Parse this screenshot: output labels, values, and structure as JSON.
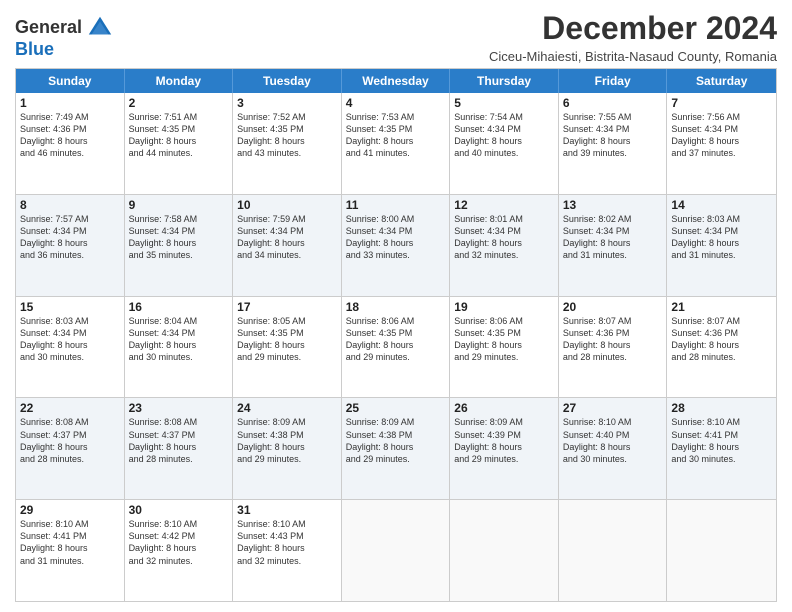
{
  "logo": {
    "general": "General",
    "blue": "Blue"
  },
  "header": {
    "title": "December 2024",
    "subtitle": "Ciceu-Mihaiesti, Bistrita-Nasaud County, Romania"
  },
  "days": [
    "Sunday",
    "Monday",
    "Tuesday",
    "Wednesday",
    "Thursday",
    "Friday",
    "Saturday"
  ],
  "weeks": [
    [
      {
        "day": 1,
        "lines": [
          "Sunrise: 7:49 AM",
          "Sunset: 4:36 PM",
          "Daylight: 8 hours",
          "and 46 minutes."
        ]
      },
      {
        "day": 2,
        "lines": [
          "Sunrise: 7:51 AM",
          "Sunset: 4:35 PM",
          "Daylight: 8 hours",
          "and 44 minutes."
        ]
      },
      {
        "day": 3,
        "lines": [
          "Sunrise: 7:52 AM",
          "Sunset: 4:35 PM",
          "Daylight: 8 hours",
          "and 43 minutes."
        ]
      },
      {
        "day": 4,
        "lines": [
          "Sunrise: 7:53 AM",
          "Sunset: 4:35 PM",
          "Daylight: 8 hours",
          "and 41 minutes."
        ]
      },
      {
        "day": 5,
        "lines": [
          "Sunrise: 7:54 AM",
          "Sunset: 4:34 PM",
          "Daylight: 8 hours",
          "and 40 minutes."
        ]
      },
      {
        "day": 6,
        "lines": [
          "Sunrise: 7:55 AM",
          "Sunset: 4:34 PM",
          "Daylight: 8 hours",
          "and 39 minutes."
        ]
      },
      {
        "day": 7,
        "lines": [
          "Sunrise: 7:56 AM",
          "Sunset: 4:34 PM",
          "Daylight: 8 hours",
          "and 37 minutes."
        ]
      }
    ],
    [
      {
        "day": 8,
        "lines": [
          "Sunrise: 7:57 AM",
          "Sunset: 4:34 PM",
          "Daylight: 8 hours",
          "and 36 minutes."
        ]
      },
      {
        "day": 9,
        "lines": [
          "Sunrise: 7:58 AM",
          "Sunset: 4:34 PM",
          "Daylight: 8 hours",
          "and 35 minutes."
        ]
      },
      {
        "day": 10,
        "lines": [
          "Sunrise: 7:59 AM",
          "Sunset: 4:34 PM",
          "Daylight: 8 hours",
          "and 34 minutes."
        ]
      },
      {
        "day": 11,
        "lines": [
          "Sunrise: 8:00 AM",
          "Sunset: 4:34 PM",
          "Daylight: 8 hours",
          "and 33 minutes."
        ]
      },
      {
        "day": 12,
        "lines": [
          "Sunrise: 8:01 AM",
          "Sunset: 4:34 PM",
          "Daylight: 8 hours",
          "and 32 minutes."
        ]
      },
      {
        "day": 13,
        "lines": [
          "Sunrise: 8:02 AM",
          "Sunset: 4:34 PM",
          "Daylight: 8 hours",
          "and 31 minutes."
        ]
      },
      {
        "day": 14,
        "lines": [
          "Sunrise: 8:03 AM",
          "Sunset: 4:34 PM",
          "Daylight: 8 hours",
          "and 31 minutes."
        ]
      }
    ],
    [
      {
        "day": 15,
        "lines": [
          "Sunrise: 8:03 AM",
          "Sunset: 4:34 PM",
          "Daylight: 8 hours",
          "and 30 minutes."
        ]
      },
      {
        "day": 16,
        "lines": [
          "Sunrise: 8:04 AM",
          "Sunset: 4:34 PM",
          "Daylight: 8 hours",
          "and 30 minutes."
        ]
      },
      {
        "day": 17,
        "lines": [
          "Sunrise: 8:05 AM",
          "Sunset: 4:35 PM",
          "Daylight: 8 hours",
          "and 29 minutes."
        ]
      },
      {
        "day": 18,
        "lines": [
          "Sunrise: 8:06 AM",
          "Sunset: 4:35 PM",
          "Daylight: 8 hours",
          "and 29 minutes."
        ]
      },
      {
        "day": 19,
        "lines": [
          "Sunrise: 8:06 AM",
          "Sunset: 4:35 PM",
          "Daylight: 8 hours",
          "and 29 minutes."
        ]
      },
      {
        "day": 20,
        "lines": [
          "Sunrise: 8:07 AM",
          "Sunset: 4:36 PM",
          "Daylight: 8 hours",
          "and 28 minutes."
        ]
      },
      {
        "day": 21,
        "lines": [
          "Sunrise: 8:07 AM",
          "Sunset: 4:36 PM",
          "Daylight: 8 hours",
          "and 28 minutes."
        ]
      }
    ],
    [
      {
        "day": 22,
        "lines": [
          "Sunrise: 8:08 AM",
          "Sunset: 4:37 PM",
          "Daylight: 8 hours",
          "and 28 minutes."
        ]
      },
      {
        "day": 23,
        "lines": [
          "Sunrise: 8:08 AM",
          "Sunset: 4:37 PM",
          "Daylight: 8 hours",
          "and 28 minutes."
        ]
      },
      {
        "day": 24,
        "lines": [
          "Sunrise: 8:09 AM",
          "Sunset: 4:38 PM",
          "Daylight: 8 hours",
          "and 29 minutes."
        ]
      },
      {
        "day": 25,
        "lines": [
          "Sunrise: 8:09 AM",
          "Sunset: 4:38 PM",
          "Daylight: 8 hours",
          "and 29 minutes."
        ]
      },
      {
        "day": 26,
        "lines": [
          "Sunrise: 8:09 AM",
          "Sunset: 4:39 PM",
          "Daylight: 8 hours",
          "and 29 minutes."
        ]
      },
      {
        "day": 27,
        "lines": [
          "Sunrise: 8:10 AM",
          "Sunset: 4:40 PM",
          "Daylight: 8 hours",
          "and 30 minutes."
        ]
      },
      {
        "day": 28,
        "lines": [
          "Sunrise: 8:10 AM",
          "Sunset: 4:41 PM",
          "Daylight: 8 hours",
          "and 30 minutes."
        ]
      }
    ],
    [
      {
        "day": 29,
        "lines": [
          "Sunrise: 8:10 AM",
          "Sunset: 4:41 PM",
          "Daylight: 8 hours",
          "and 31 minutes."
        ]
      },
      {
        "day": 30,
        "lines": [
          "Sunrise: 8:10 AM",
          "Sunset: 4:42 PM",
          "Daylight: 8 hours",
          "and 32 minutes."
        ]
      },
      {
        "day": 31,
        "lines": [
          "Sunrise: 8:10 AM",
          "Sunset: 4:43 PM",
          "Daylight: 8 hours",
          "and 32 minutes."
        ]
      },
      null,
      null,
      null,
      null
    ]
  ],
  "shaded_weeks": [
    1,
    3
  ]
}
